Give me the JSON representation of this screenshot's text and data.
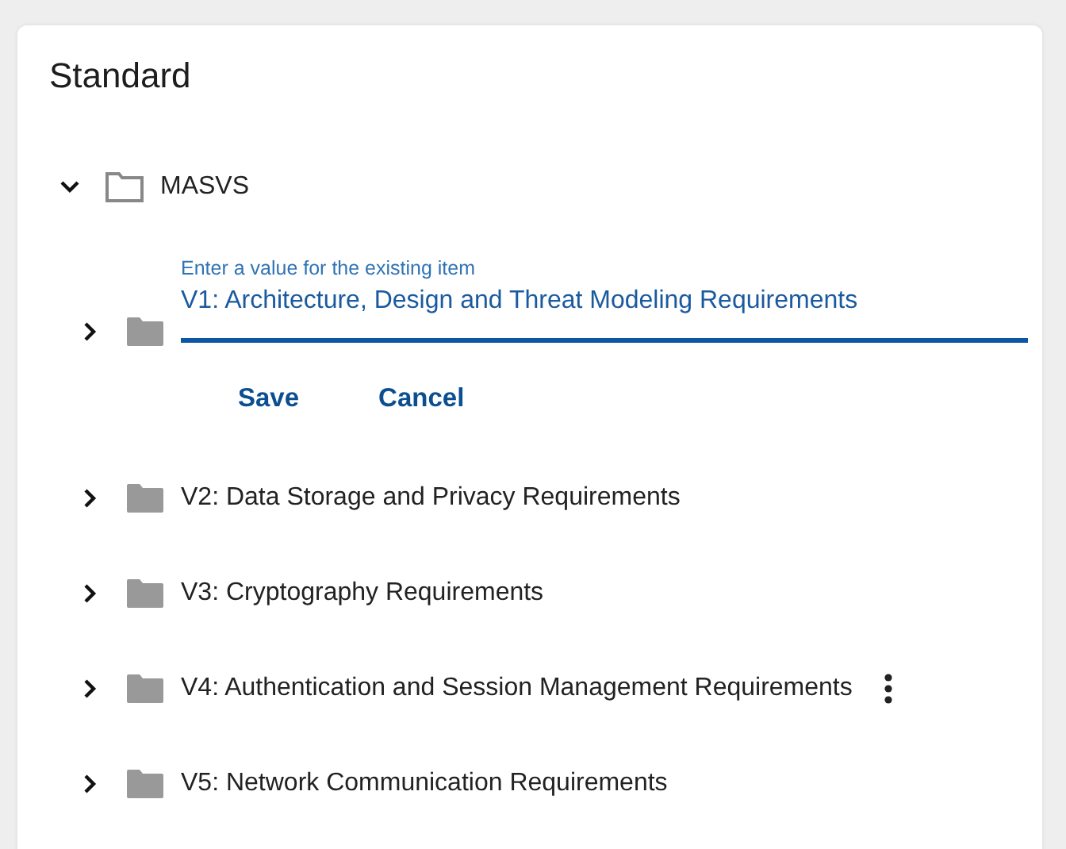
{
  "card": {
    "title": "Standard"
  },
  "tree": {
    "label": "MASVS",
    "expanded": true,
    "children": [
      {
        "kind": "editing",
        "expanded": false,
        "field": {
          "label": "Enter a value for the existing item",
          "value": "V1: Architecture, Design and Threat Modeling Requirements"
        },
        "actions": [
          "Save",
          "Cancel"
        ]
      },
      {
        "kind": "item",
        "label": "V2: Data Storage and Privacy Requirements",
        "expanded": false,
        "menu": false
      },
      {
        "kind": "item",
        "label": "V3: Cryptography Requirements",
        "expanded": false,
        "menu": false
      },
      {
        "kind": "item",
        "label": "V4: Authentication and Session Management Requirements",
        "expanded": false,
        "menu": true
      },
      {
        "kind": "item",
        "label": "V5: Network Communication Requirements",
        "expanded": false,
        "menu": false
      }
    ]
  }
}
